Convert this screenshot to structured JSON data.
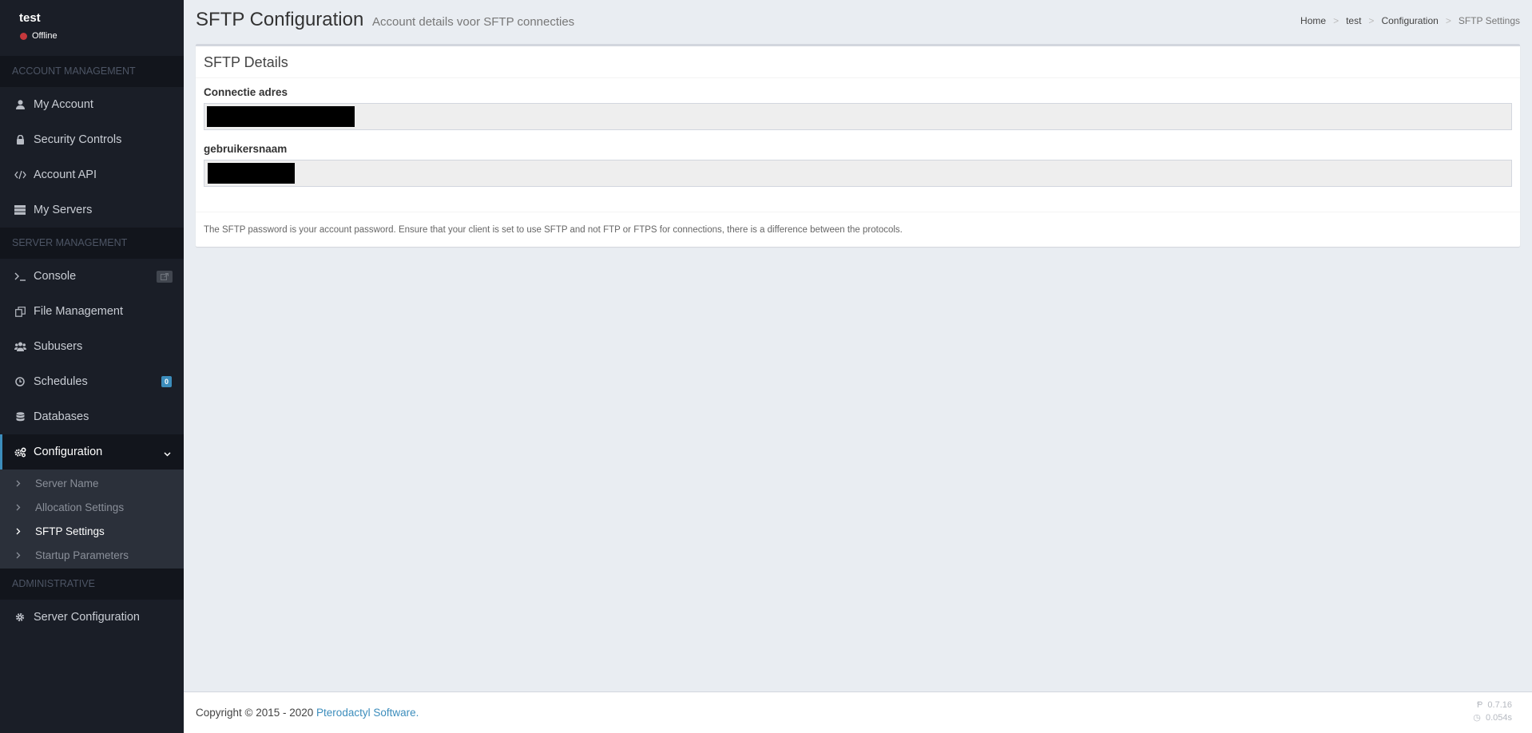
{
  "user": {
    "name": "test",
    "status": "Offline"
  },
  "sidebar": {
    "account_header": "ACCOUNT MANAGEMENT",
    "account_items": [
      {
        "label": "My Account",
        "icon": "user-icon"
      },
      {
        "label": "Security Controls",
        "icon": "lock-icon"
      },
      {
        "label": "Account API",
        "icon": "code-icon"
      },
      {
        "label": "My Servers",
        "icon": "server-icon"
      }
    ],
    "server_header": "SERVER MANAGEMENT",
    "server_items": [
      {
        "label": "Console",
        "icon": "terminal-icon"
      },
      {
        "label": "File Management",
        "icon": "files-icon"
      },
      {
        "label": "Subusers",
        "icon": "users-icon"
      },
      {
        "label": "Schedules",
        "icon": "clock-icon",
        "badge": "0"
      },
      {
        "label": "Databases",
        "icon": "database-icon"
      },
      {
        "label": "Configuration",
        "icon": "cogs-icon"
      }
    ],
    "config_subitems": [
      "Server Name",
      "Allocation Settings",
      "SFTP Settings",
      "Startup Parameters"
    ],
    "admin_header": "ADMINISTRATIVE",
    "admin_items": [
      {
        "label": "Server Configuration",
        "icon": "gear-icon"
      }
    ]
  },
  "header": {
    "title": "SFTP Configuration",
    "subtitle": "Account details voor SFTP connecties",
    "breadcrumb": [
      "Home",
      "test",
      "Configuration",
      "SFTP Settings"
    ]
  },
  "box": {
    "title": "SFTP Details",
    "fields": [
      {
        "label": "Connectie adres"
      },
      {
        "label": "gebruikersnaam"
      }
    ],
    "footer_text": "The SFTP password is your account password. Ensure that your client is set to use SFTP and not FTP or FTPS for connections, there is a difference between the protocols."
  },
  "footer": {
    "copyright": "Copyright © 2015 - 2020 ",
    "link": "Pterodactyl Software.",
    "version": "0.7.16",
    "time": "0.054s"
  },
  "colors": {
    "accent": "#3c8dbc",
    "sidebar_bg": "#1a1e27",
    "offline": "#c5383c"
  }
}
